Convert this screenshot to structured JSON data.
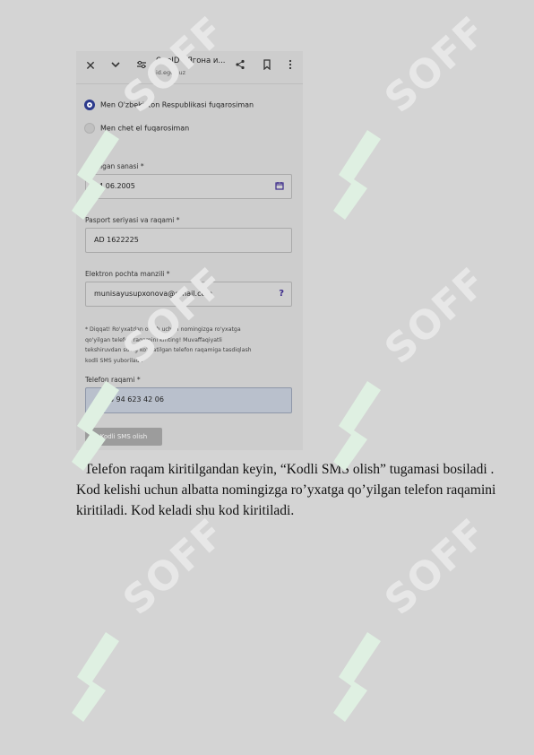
{
  "watermark": {
    "text": "SOFF",
    "color": "#e7e7e7",
    "mark_color": "#dff0e2"
  },
  "browser": {
    "tab_title": "OneID - Ягона и...",
    "url": "id.egov.uz",
    "icons": [
      "close-icon",
      "chevron-down-icon",
      "site-settings-icon",
      "share-icon",
      "bookmark-icon",
      "more-icon"
    ]
  },
  "form": {
    "citizen_radio": "Men O'zbekiston Respublikasi fuqarosiman",
    "foreign_radio": "Men chet el fuqarosiman",
    "birth_label": "Tug'ilgan sanasi",
    "birth_value": "14.06.2005",
    "passport_label": "Pasport seriyasi va raqami",
    "passport_value": "AD 1622225",
    "email_label": "Elektron pochta manzili",
    "email_value": "munisayusupxonova@gmail.com",
    "note_lines": [
      "* Diqqat! Ro'yxatdan o'tish uchun nomingizga ro'yxatga",
      "qo'yilgan telefon raqamini kiriting! Muvaffaqiyatli",
      "tekshiruvdan so'ng ko'rsatilgan telefon raqamiga tasdiqlash",
      "kodli SMS yuboriladi."
    ],
    "phone_label": "Telefon raqami",
    "phone_value": "+998 94 623 42 06",
    "sms_button": "Kodli SMS olish",
    "required_mark": "*",
    "accent": "#2c3a8c"
  },
  "document": {
    "paragraph": "Telefon raqam kiritilgandan keyin, “Kodli SMS olish” tugamasi bosiladi .  Kod kelishi uchun albatta nomingizga ro’yxatga qo’yilgan telefon raqamini kiritiladi. Kod keladi shu kod kiritiladi."
  }
}
